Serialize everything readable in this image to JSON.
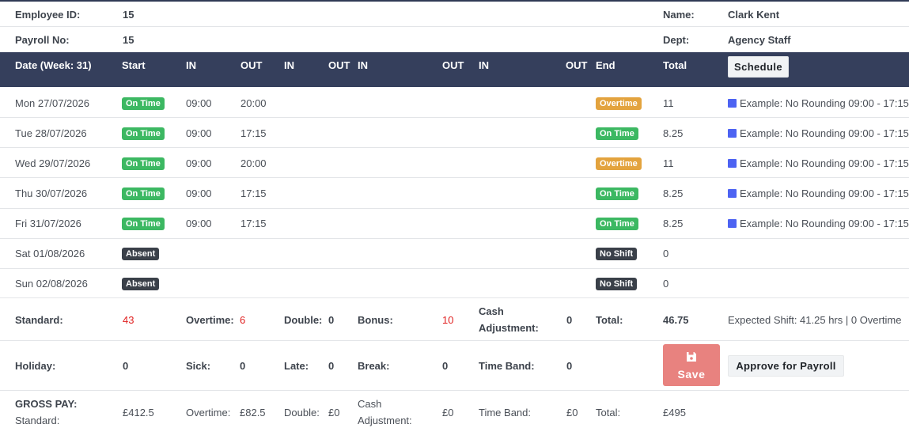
{
  "employee": {
    "id_label": "Employee ID:",
    "id_value": "15",
    "payroll_label": "Payroll No:",
    "payroll_value": "15",
    "name_label": "Name:",
    "name_value": "Clark Kent",
    "dept_label": "Dept:",
    "dept_value": "Agency Staff"
  },
  "table_header": {
    "date": "Date (Week: 31)",
    "start": "Start",
    "in1": "IN",
    "out1": "OUT",
    "in2": "IN",
    "out2": "OUT",
    "in3": "IN",
    "out3": "OUT",
    "in4": "IN",
    "out4": "OUT",
    "end": "End",
    "total": "Total",
    "schedule_button": "Schedule"
  },
  "rows": [
    {
      "date": "Mon 27/07/2026",
      "start": "On Time",
      "in": "09:00",
      "out": "20:00",
      "end": "Overtime",
      "total": "11",
      "schedule": "Example: No Rounding 09:00 - 17:15"
    },
    {
      "date": "Tue 28/07/2026",
      "start": "On Time",
      "in": "09:00",
      "out": "17:15",
      "end": "On Time",
      "total": "8.25",
      "schedule": "Example: No Rounding 09:00 - 17:15"
    },
    {
      "date": "Wed 29/07/2026",
      "start": "On Time",
      "in": "09:00",
      "out": "20:00",
      "end": "Overtime",
      "total": "11",
      "schedule": "Example: No Rounding 09:00 - 17:15"
    },
    {
      "date": "Thu 30/07/2026",
      "start": "On Time",
      "in": "09:00",
      "out": "17:15",
      "end": "On Time",
      "total": "8.25",
      "schedule": "Example: No Rounding 09:00 - 17:15"
    },
    {
      "date": "Fri 31/07/2026",
      "start": "On Time",
      "in": "09:00",
      "out": "17:15",
      "end": "On Time",
      "total": "8.25",
      "schedule": "Example: No Rounding 09:00 - 17:15"
    },
    {
      "date": "Sat 01/08/2026",
      "start": "Absent",
      "end": "No Shift",
      "total": "0"
    },
    {
      "date": "Sun 02/08/2026",
      "start": "Absent",
      "end": "No Shift",
      "total": "0"
    }
  ],
  "summary": {
    "standard_label": "Standard:",
    "standard_value": "43",
    "overtime_label": "Overtime:",
    "overtime_value": "6",
    "double_label": "Double:",
    "double_value": "0",
    "bonus_label": "Bonus:",
    "bonus_value": "10",
    "cash_label_1": "Cash",
    "cash_label_2": "Adjustment:",
    "cash_value": "0",
    "total_label": "Total:",
    "total_value": "46.75",
    "expected": "Expected Shift: 41.25 hrs | 0 Overtime"
  },
  "summary2": {
    "holiday_label": "Holiday:",
    "holiday_value": "0",
    "sick_label": "Sick:",
    "sick_value": "0",
    "late_label": "Late:",
    "late_value": "0",
    "break_label": "Break:",
    "break_value": "0",
    "timeband_label": "Time Band:",
    "timeband_value": "0",
    "save_button": "Save",
    "approve_button": "Approve for Payroll"
  },
  "gross": {
    "title": "GROSS PAY:",
    "standard_label": "Standard:",
    "standard_value": "£412.5",
    "overtime_label": "Overtime:",
    "overtime_value": "£82.5",
    "double_label": "Double:",
    "double_value": "£0",
    "cash_label_1": "Cash",
    "cash_label_2": "Adjustment:",
    "cash_value": "£0",
    "timeband_label": "Time Band:",
    "timeband_value": "£0",
    "total_label": "Total:",
    "total_value": "£495"
  },
  "colors": {
    "header_bg": "#353f5c",
    "on_time": "#3cb862",
    "overtime": "#e3a33e",
    "absent": "#3a4049",
    "schedule_square": "#4d63f2",
    "save_button": "#e8827f",
    "highlight_red": "#e01f1f"
  },
  "icons": {
    "save": "floppy-disk-icon",
    "schedule_marker": "schedule-square-icon"
  }
}
